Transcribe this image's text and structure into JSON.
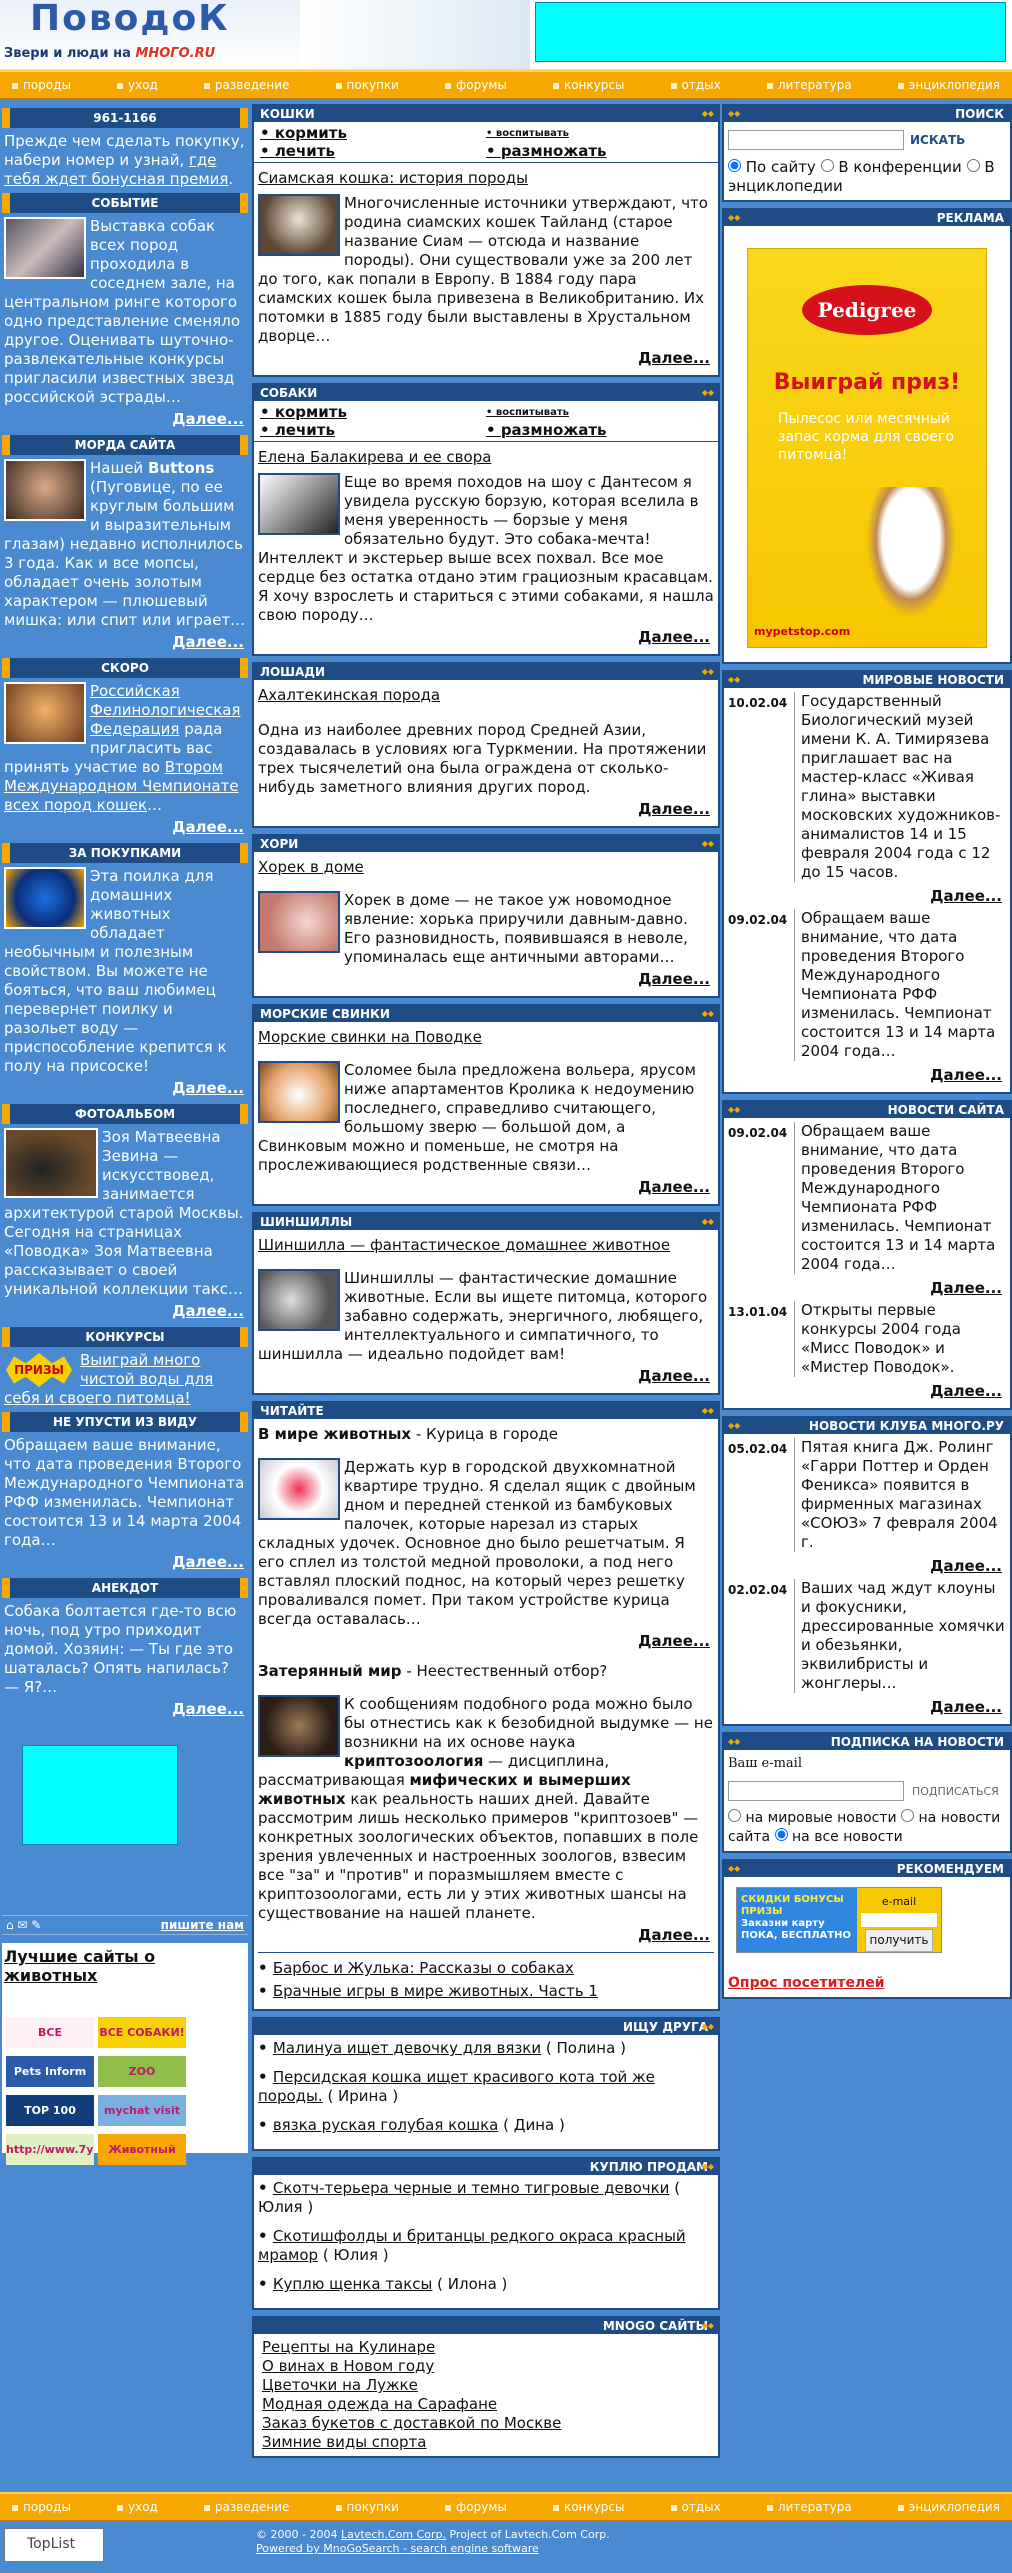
{
  "site": {
    "logo_text": "ПоводоК",
    "logo_suffix": "МНОГО.RU",
    "tagline": "Звери и люди на"
  },
  "nav": [
    "породы",
    "уход",
    "разведение",
    "покупки",
    "форумы",
    "конкурсы",
    "отдых",
    "литература",
    "энциклопедия"
  ],
  "left": {
    "phone": {
      "head": "961-1166",
      "text": "Прежде чем сделать покупку, набери номер и узнай,",
      "link": "где тебя ждет бонусная премия",
      "end": "."
    },
    "event": {
      "head": "СОБЫТИЕ",
      "text": "Выставка собак всех пород проходила в соседнем зале, на центральном ринге которого одно представление сменяло другое. Оценивать шуточно-развлекательные конкурсы пригласили известных звезд российской эстрады…",
      "more": "Далее..."
    },
    "face": {
      "head": "МОРДА САЙТА",
      "pre": "Нашей ",
      "name": "Buttons",
      "text": "(Пуговице, по ее круглым большим и выразительным глазам) недавно исполнилось 3 года. Как и все мопсы, обладает очень золотым характером — плюшевый мишка: или спит или играет…",
      "more": "Далее..."
    },
    "soon": {
      "head": "СКОРО",
      "link1": "Российская Фелинологическая Федерация",
      "mid": "рада пригласить вас принять участие во",
      "link2": "Втором Международном Чемпионате всех пород кошек",
      "end": "…",
      "more": "Далее..."
    },
    "shop": {
      "head": "ЗА ПОКУПКАМИ",
      "text": "Эта поилка для домашних животных обладает необычным и полезным свойством. Вы можете не бояться, что ваш любимец перевернет поилку и разольет воду — приспособление крепится к полу на присоске!",
      "more": "Далее..."
    },
    "photo": {
      "head": "ФОТОАЛЬБОМ",
      "text": "Зоя Матвеевна Зевина — искусствовед, занимается архитектурой старой Москвы. Сегодня на страницах «Поводка» Зоя Матвеевна рассказывает о своей уникальной коллекции такс…",
      "more": "Далее..."
    },
    "contests": {
      "head": "КОНКУРСЫ",
      "badge": "ПРИЗЫ",
      "link": "Выиграй много чистой воды для себя и своего питомца!"
    },
    "miss": {
      "head": "НЕ УПУСТИ ИЗ ВИДУ",
      "text": "Обращаем ваше внимание, что дата проведения Второго Международного Чемпионата РФФ изменилась. Чемпионат состоится 13 и 14 марта 2004 года…",
      "more": "Далее..."
    },
    "joke": {
      "head": "АНЕКДОТ",
      "text": "Собака болтается где-то всю ночь, под утро приходит домой. Хозяин: — Ты где это шаталась? Опять напилась? — Я?…",
      "more": "Далее..."
    },
    "write": "пишите нам",
    "best": "Лучшие сайты о животных",
    "banners": [
      "ВСЕ",
      "ВСЕ СОБАКИ!",
      "Pets Inform",
      "ZOO",
      "TOP 100",
      "mychat visit",
      "http://www.7ya.ru",
      "Животный мир"
    ]
  },
  "mid": {
    "cats": {
      "head": "КОШКИ",
      "r1": "кормить",
      "r2": "воспитывать",
      "r3": "лечить",
      "r4": "размножать",
      "title": "Сиамская кошка: история породы",
      "text": "Многочисленные источники утверждают, что родина сиамских кошек Тайланд (старое название Сиам — отсюда и название породы). Они существовали уже за 200 лет до того, как попали в Европу. В 1884 году пара сиамских кошек была привезена в Великобританию. Их потомки в 1885 году были выставлены в Хрустальном дворце…",
      "more": "Далее..."
    },
    "dogs": {
      "head": "СОБАКИ",
      "r1": "кормить",
      "r2": "воспитывать",
      "r3": "лечить",
      "r4": "размножать",
      "title": "Елена Балакирева и ее свора",
      "text": "Еще во время походов на шоу с Дантесом я увидела русскую борзую, которая вселила в меня уверенность — борзые у меня обязательно будут. Это собака-мечта! Интеллект и экстерьер выше всех похвал. Все мое сердце без остатка отдано этим грациозным красавцам. Я хочу взрослеть и стариться с этими собаками, я нашла свою породу…",
      "more": "Далее..."
    },
    "horses": {
      "head": "ЛОШАДИ",
      "title": "Ахалтекинская порода",
      "text": "Одна из наиболее древних пород Средней Азии, создавалась в условиях юга Туркмении. На протяжении трех тысячелетий она была огражденa от сколько-нибудь заметного влияния других пород.",
      "more": "Далее..."
    },
    "ferrets": {
      "head": "ХОРИ",
      "title": "Хорек в доме",
      "text": "Хорек в доме — не такое уж новомодное явление: хорька приручили давным-давно. Его разновидность, появившаяся в неволе, упоминалась еще античными авторами…",
      "more": "Далее..."
    },
    "pigs": {
      "head": "МОРСКИЕ СВИНКИ",
      "title": "Морские свинки на Поводке",
      "text": "Соломее была предложена вольера, ярусом ниже апартаментов Кролика к недоумению последнего, справедливо считающего, большому зверю — большой дом, а Свинковым можно и поменьше, не смотря на прослеживающиеся родственные связи…",
      "more": "Далее..."
    },
    "chin": {
      "head": "ШИНШИЛЛЫ",
      "title": "Шиншилла — фантастическое домашнее животное",
      "text": "Шиншиллы — фантастические домашние животные. Если вы ищете питомца, которого забавно содержать, энергичного, любящего, интеллектуального и симпатичного, то шиншилла — идеально подойдет вам!",
      "more": "Далее..."
    },
    "read": {
      "head": "ЧИТАЙТЕ",
      "t1a": "В мире животных",
      "t1b": " - Курица в городе",
      "text1": "Держать кур в городской двухкомнатной квартире трудно. Я сделал ящик с двойным дном и передней стенкой из бамбуковых палочек, которые нарезал из старых складных удочек. Основное дно было решетчатым. Я его сплел из толстой медной проволоки, а под него вставлял плоский поднос, на который через решетку проваливался помет. При таком устройстве курица всегда оставалась…",
      "more1": "Далее...",
      "t2a": "Затерянный мир",
      "t2b": " - Неестественный отбор?",
      "text2a": "К сообщениям подобного рода можно было бы отнестись как к безобидной выдумке — не возникни на их основе наука ",
      "text2b": "криптозоология",
      "text2c": " — дисциплина, рассматривающая ",
      "text2d": "мифических и вымерших животных",
      "text2e": " как реальность наших дней. Давайте рассмотрим лишь несколько примеров \"криптозоев\" — конкретных зоологических объектов, попавших в поле зрения увлеченных и настроенных зоологов, взвесим все \"за\" и \"против\" и поразмышляем вместе с криптозоологами, есть ли у этих животных шансы на существование на нашей планете.",
      "more2": "Далее...",
      "links": [
        "Барбос и Жулька: Рассказы о собаках",
        "Брачные игры в мире животных. Часть 1"
      ]
    },
    "friend": {
      "head": "ИЩУ ДРУГА",
      "items": [
        {
          "t": "Малинуа ищет девочку для вязки",
          "n": " ( Полина )"
        },
        {
          "t": "Персидская кошка ищет красивого кота той же породы.",
          "n": " ( Ирина )"
        },
        {
          "t": "вязка руская голубая кошка",
          "n": " ( Дина )"
        }
      ]
    },
    "buy": {
      "head": "КУПЛЮ ПРОДАМ",
      "items": [
        {
          "t": "Скотч-терьера черные и темно тигровые девочки",
          "n": " ( Юлия )"
        },
        {
          "t": "Скотишфолды и британцы редкого окраса красный мрамор",
          "n": " ( Юлия )"
        },
        {
          "t": "Куплю щенка таксы",
          "n": " ( Илона )"
        }
      ]
    },
    "mnogo": {
      "head": "MNOGO САЙТЫ",
      "items": [
        "Рецепты на Кулинаре",
        "О винах в Новом году",
        "Цветочки на Лужке",
        "Модная одежда на Сарафане",
        "Заказ букетов с доставкой по Москве",
        "Зимние виды спорта"
      ]
    }
  },
  "right": {
    "search": {
      "head": "ПОИСК",
      "button": "ИСКАТЬ",
      "o1": "По сайту",
      "o2": "В конференции",
      "o3": "В энциклопедии"
    },
    "ad": {
      "head": "РЕКЛАМА",
      "brand": "Pedigree",
      "win": "Выиграй приз!",
      "text": "Пылесос или месячный запас корма для своего питомца!",
      "site": "mypetstop.com"
    },
    "world": {
      "head": "МИРОВЫЕ НОВОСТИ",
      "items": [
        {
          "d": "10.02.04",
          "t": "Государственный Биологический музей имени К. А. Тимирязева приглашает вас на мастер-класс «Живая глина» выставки московских художников-анималистов 14 и 15 февраля 2004 года с 12 до 15 часов."
        },
        {
          "d": "09.02.04",
          "t": "Обращаем ваше внимание, что дата проведения Второго Международного Чемпионата РФФ изменилась. Чемпионат состоится 13 и 14 марта 2004 года…"
        }
      ],
      "more": "Далее..."
    },
    "site": {
      "head": "НОВОСТИ САЙТА",
      "items": [
        {
          "d": "09.02.04",
          "t": "Обращаем ваше внимание, что дата проведения Второго Международного Чемпионата РФФ изменилась. Чемпионат состоится 13 и 14 марта 2004 года…"
        },
        {
          "d": "13.01.04",
          "t": "Открыты первые конкурсы 2004 года «Мисс Поводок» и «Мистер Поводок»."
        }
      ],
      "more": "Далее..."
    },
    "club": {
      "head": "НОВОСТИ КЛУБА МНОГО.РУ",
      "items": [
        {
          "d": "05.02.04",
          "t": "Пятая книга Дж. Ролинг «Гарри Поттер и Орден Феникса» появится в фирменных магазинах «СОЮЗ» 7 февраля 2004 г."
        },
        {
          "d": "02.02.04",
          "t": "Ваших чад ждут клоуны и фокусники, дрессированные хомячки и обезьянки, эквилибристы и жонглеры…"
        }
      ],
      "more": "Далее..."
    },
    "sub": {
      "head": "ПОДПИСКА НА НОВОСТИ",
      "label": "Ваш e-mail",
      "button": "ПОДПИСАТЬСЯ",
      "o1": "на мировые новости",
      "o2": "на новости сайта",
      "o3": "на все новости"
    },
    "rec": {
      "head": "РЕКОМЕНДУЕМ",
      "email": "e-mail",
      "get": "получить",
      "b1": "СКИДКИ БОНУСЫ ПРИЗЫ",
      "b2": "Заказни карту",
      "b3": "ПОКА, БЕСПЛАТНО",
      "poll": "Опрос посетителей"
    }
  },
  "footer": {
    "copy": "© 2000 - 2004",
    "copy_link": "Lavtech.Com Corp.",
    "copy_rest": "Project of Lavtech.Com Corp.",
    "powered": "Powered by MnoGoSearch - search engine software",
    "toplist": "TopList"
  }
}
